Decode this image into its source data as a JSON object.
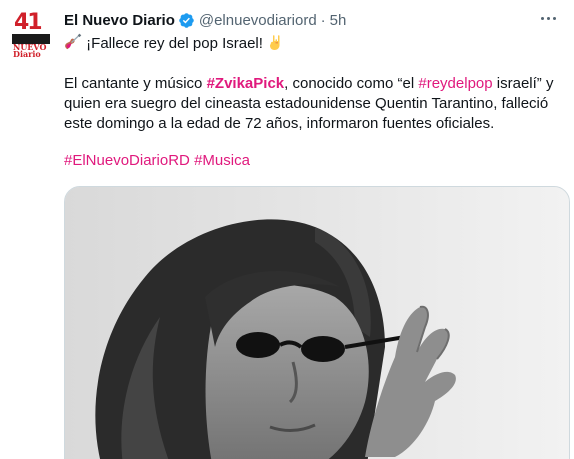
{
  "tweet": {
    "author_name": "El Nuevo Diario",
    "handle": "@elnuevodiariord",
    "separator": "·",
    "time": "5h",
    "avatar": {
      "number": "41",
      "word1": "NUEVO",
      "word2": "Diario",
      "brand_color": "#d0202a"
    },
    "line1": {
      "emoji_icon": "guitar-icon",
      "text": "¡Fallece rey del pop Israel!",
      "emoji2_icon": "rock-hand-icon"
    },
    "para2": {
      "t1": "El cantante y músico ",
      "tag1": "#ZvikaPick",
      "t2": ", conocido como “el ",
      "tag2": "#reydelpop",
      "t3": " israelí” y quien era suegro del cineasta estadounidense Quentin Tarantino, falleció este domingo a la edad de 72 años, informaron fuentes oficiales."
    },
    "hashtags": {
      "tag1": "#ElNuevoDiarioRD",
      "tag2": "#Musica"
    },
    "media_icon": "photo-man-with-sunglasses",
    "hashtag_color": "#e0197d",
    "verified_color": "#1d9bf0"
  }
}
